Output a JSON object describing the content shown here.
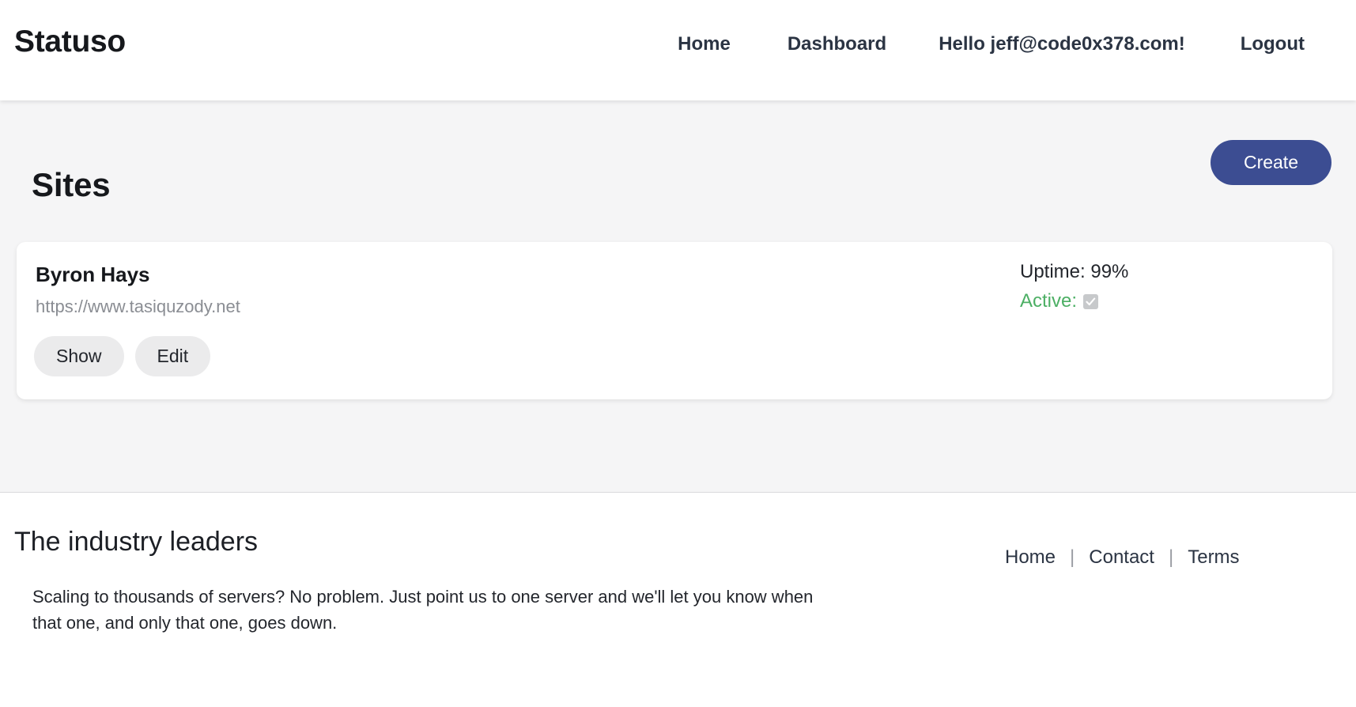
{
  "header": {
    "brand": "Statuso",
    "nav": [
      {
        "key": "home",
        "label": "Home"
      },
      {
        "key": "dashboard",
        "label": "Dashboard"
      },
      {
        "key": "greeting",
        "label": "Hello jeff@code0x378.com!"
      },
      {
        "key": "logout",
        "label": "Logout"
      }
    ]
  },
  "page": {
    "title": "Sites",
    "create_label": "Create"
  },
  "sites": [
    {
      "name": "Byron Hays",
      "url": "https://www.tasiquzody.net",
      "show_label": "Show",
      "edit_label": "Edit",
      "uptime_label": "Uptime: 99%",
      "active_label": "Active:",
      "active_checked": true
    }
  ],
  "footer": {
    "title": "The industry leaders",
    "text": "Scaling to thousands of servers? No problem. Just point us to one server and we'll let you know when that one, and only that one, goes down.",
    "links": [
      {
        "key": "home",
        "label": "Home"
      },
      {
        "key": "contact",
        "label": "Contact"
      },
      {
        "key": "terms",
        "label": "Terms"
      }
    ],
    "separator": "|"
  },
  "colors": {
    "accent": "#3c4d92",
    "active_green": "#4caf64",
    "muted": "#8a8d93",
    "page_bg": "#f5f5f6",
    "card_bg": "#ffffff"
  }
}
